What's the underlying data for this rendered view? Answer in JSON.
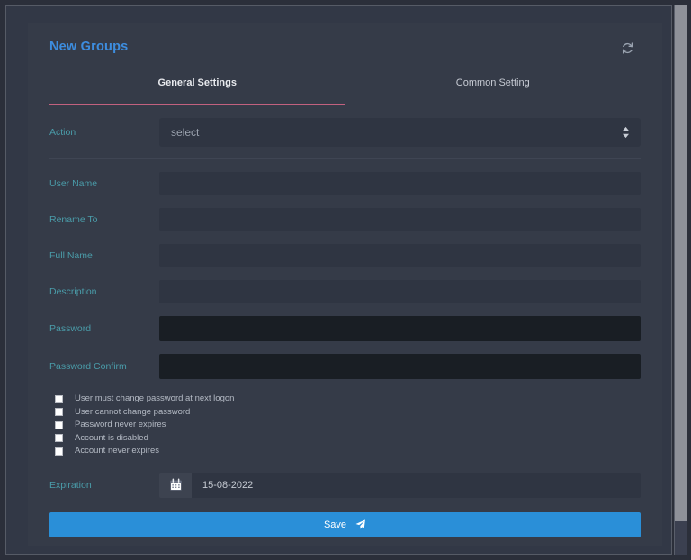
{
  "window": {
    "scrollbar_name": "vertical-scrollbar"
  },
  "header": {
    "title": "New Groups",
    "refresh_icon": "refresh-icon"
  },
  "tabs": [
    {
      "label": "General Settings",
      "active": true
    },
    {
      "label": "Common Setting",
      "active": false
    }
  ],
  "action": {
    "label": "Action",
    "selected": "select",
    "options": [
      "select"
    ]
  },
  "fields": [
    {
      "label": "User Name",
      "value": "",
      "placeholder": "",
      "dark": false
    },
    {
      "label": "Rename To",
      "value": "",
      "placeholder": "",
      "dark": false
    },
    {
      "label": "Full Name",
      "value": "",
      "placeholder": "",
      "dark": false
    },
    {
      "label": "Description",
      "value": "",
      "placeholder": "",
      "dark": false
    },
    {
      "label": "Password",
      "value": "",
      "placeholder": "",
      "dark": true
    },
    {
      "label": "Password Confirm",
      "value": "",
      "placeholder": "",
      "dark": true
    }
  ],
  "checkboxes": [
    {
      "label": "User must change password at next logon",
      "checked": false
    },
    {
      "label": "User cannot change password",
      "checked": false
    },
    {
      "label": "Password never expires",
      "checked": false
    },
    {
      "label": "Account is disabled",
      "checked": false
    },
    {
      "label": "Account never expires",
      "checked": false
    }
  ],
  "expiration": {
    "label": "Expiration",
    "value": "15-08-2022",
    "placeholder": "",
    "calendar_icon": "calendar-icon"
  },
  "save": {
    "label": "Save",
    "icon": "send-icon"
  },
  "colors": {
    "page_background": "#2b2f3a",
    "card_background": "#353b48",
    "input_background": "#2f3542",
    "input_background_dark": "#191e24",
    "title": "#3d8ddf",
    "label": "#4a9ca9",
    "active_tab_underline": "#c2617f",
    "accent_button": "#2a8fd8"
  }
}
